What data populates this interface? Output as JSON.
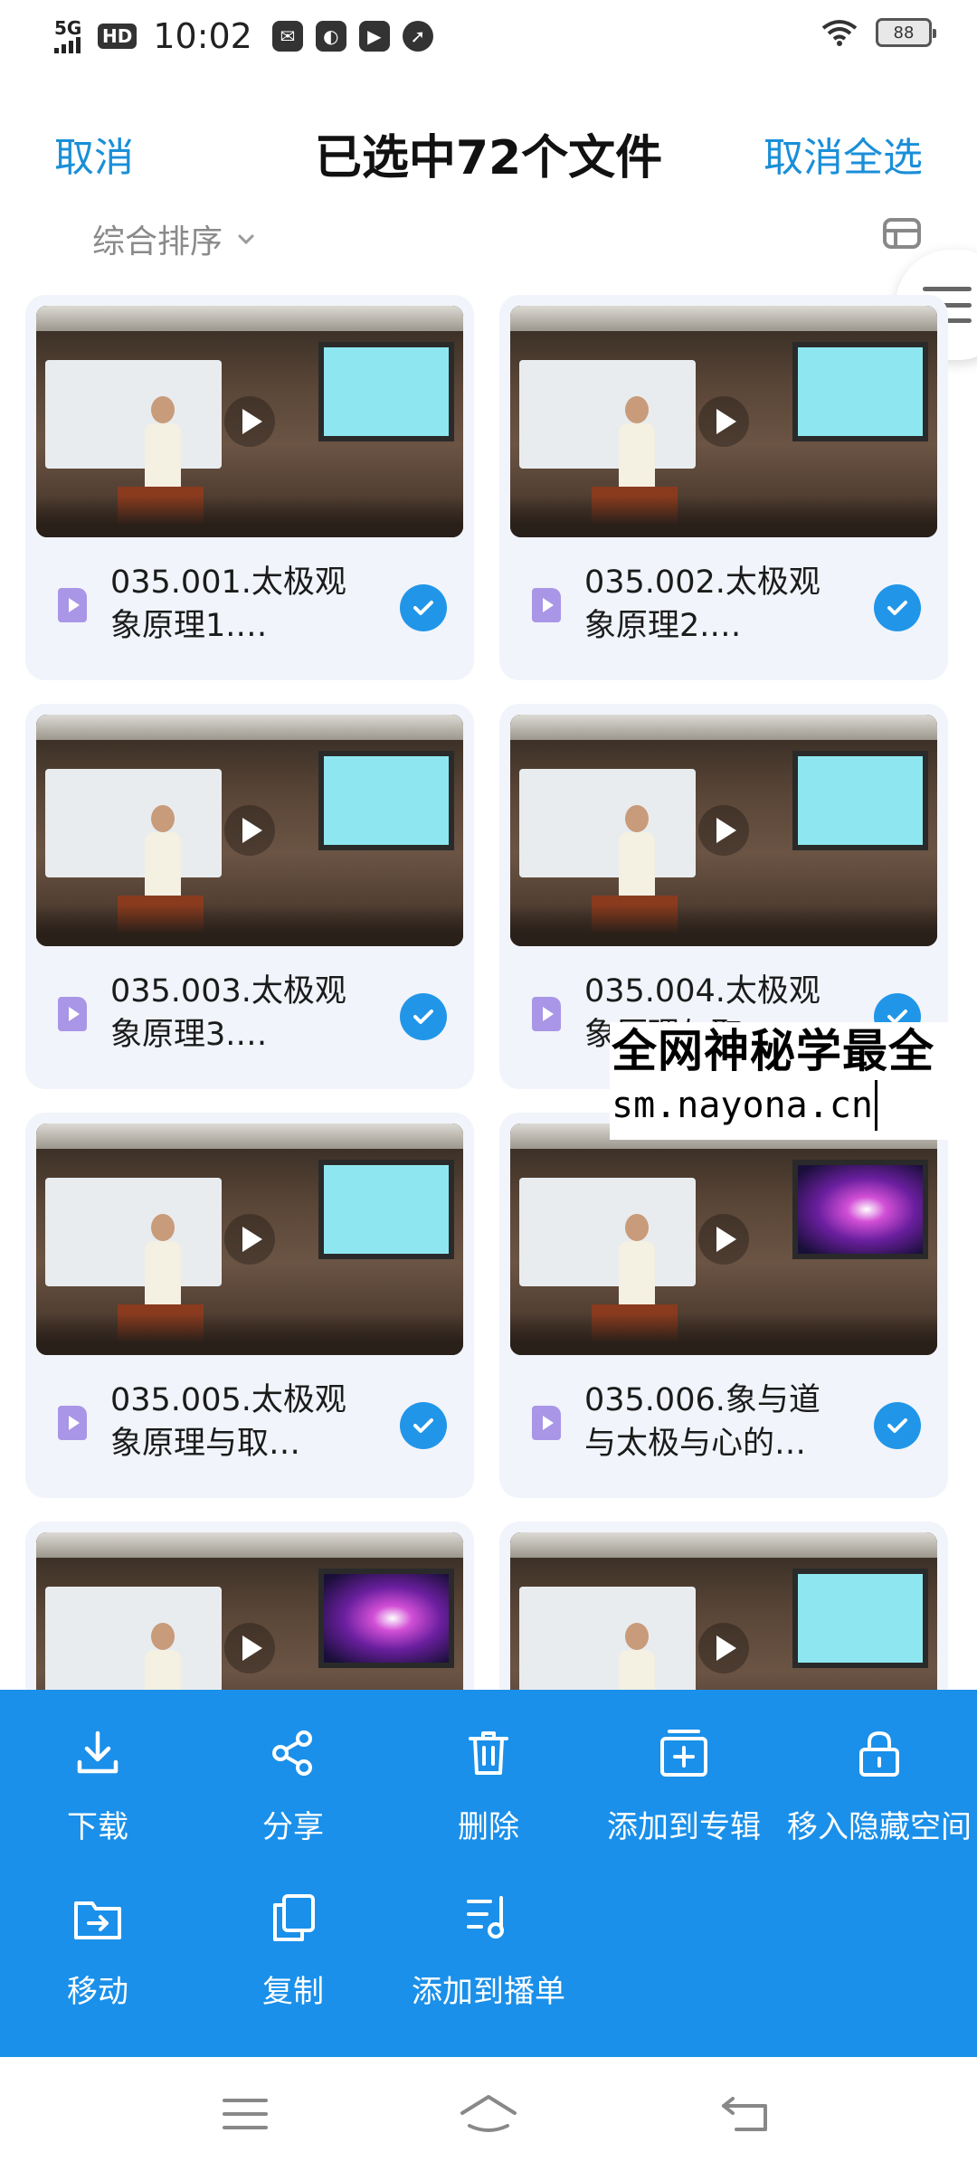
{
  "status_bar": {
    "network": "5G",
    "hd_label": "HD",
    "time": "10:02",
    "battery": "88"
  },
  "header": {
    "cancel_label": "取消",
    "title": "已选中72个文件",
    "deselect_all_label": "取消全选"
  },
  "sort": {
    "label": "综合排序"
  },
  "files": [
    {
      "name": "035.001.太极观象原理1.…",
      "screen": "cyan",
      "selected": true
    },
    {
      "name": "035.002.太极观象原理2.…",
      "screen": "cyan",
      "selected": true
    },
    {
      "name": "035.003.太极观象原理3.…",
      "screen": "cyan",
      "selected": true
    },
    {
      "name": "035.004.太极观象原理与取…",
      "screen": "cyan",
      "selected": true
    },
    {
      "name": "035.005.太极观象原理与取…",
      "screen": "cyan",
      "selected": true
    },
    {
      "name": "035.006.象与道与太极与心的…",
      "screen": "purple",
      "selected": true
    },
    {
      "name": "",
      "screen": "purple",
      "selected": true
    },
    {
      "name": "",
      "screen": "cyan",
      "selected": true
    }
  ],
  "watermark": {
    "line1": "全网神秘学最全",
    "line2": "sm.nayona.cn"
  },
  "actions": {
    "download": "下载",
    "share": "分享",
    "delete": "删除",
    "add_to_album": "添加到专辑",
    "move_to_hidden": "移入隐藏空间",
    "move": "移动",
    "copy": "复制",
    "add_to_playlist": "添加到播单"
  },
  "colors": {
    "accent": "#1a8fd8",
    "action_sheet": "#1a90ea",
    "check": "#2196e8",
    "card_bg": "#f1f4fa"
  }
}
